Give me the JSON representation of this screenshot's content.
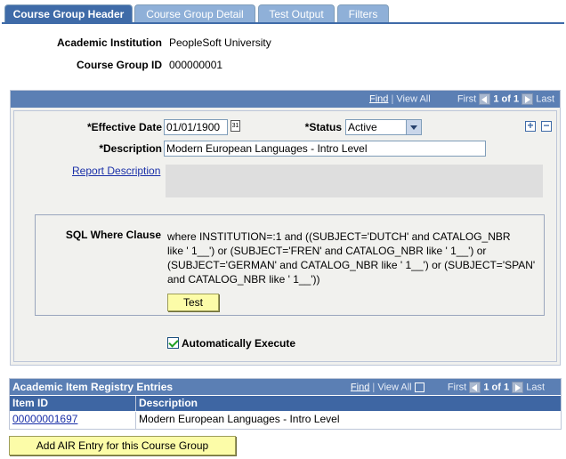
{
  "tabs": [
    {
      "label": "Course Group Header",
      "active": true
    },
    {
      "label": "Course Group Detail",
      "active": false
    },
    {
      "label": "Test Output",
      "active": false
    },
    {
      "label": "Filters",
      "active": false
    }
  ],
  "header": {
    "institution_label": "Academic Institution",
    "institution_value": "PeopleSoft University",
    "course_group_label": "Course Group ID",
    "course_group_value": "000000001"
  },
  "scroll_nav": {
    "find": "Find",
    "view_all": "View All",
    "first": "First",
    "count": "1 of 1",
    "last": "Last"
  },
  "form": {
    "effective_date_label": "*Effective Date",
    "effective_date_value": "01/01/1900",
    "calendar_icon_text": "31",
    "status_label": "*Status",
    "status_value": "Active",
    "description_label": "*Description",
    "description_value": "Modern European Languages - Intro Level",
    "report_description_link": "Report Description",
    "report_description_value": "",
    "add_row": "+",
    "delete_row": "−"
  },
  "sql": {
    "label": "SQL Where Clause",
    "lines": [
      "where INSTITUTION=:1 and ((SUBJECT='DUTCH' and CATALOG_NBR",
      "like ' 1__') or (SUBJECT='FREN' and CATALOG_NBR like ' 1__') or",
      "(SUBJECT='GERMAN' and CATALOG_NBR like ' 1__') or (SUBJECT='SPAN'",
      "and CATALOG_NBR like ' 1__'))"
    ],
    "test_button": "Test"
  },
  "auto_execute": {
    "label": "Automatically Execute",
    "checked": true
  },
  "air_grid": {
    "title": "Academic Item Registry Entries",
    "find": "Find",
    "view_all": "View All",
    "first": "First",
    "count": "1 of 1",
    "last": "Last",
    "columns": [
      "Item ID",
      "Description"
    ],
    "rows": [
      {
        "item_id": "00000001697",
        "description": "Modern European Languages - Intro Level"
      }
    ]
  },
  "add_air_button": "Add AIR Entry for this Course Group",
  "colors": {
    "tab_active": "#3f6ba8",
    "tab_inactive": "#8fb0d8",
    "grid_header": "#3e66a3",
    "button_bg": "#fcfca8",
    "panel_bg": "#f1f1ee"
  }
}
